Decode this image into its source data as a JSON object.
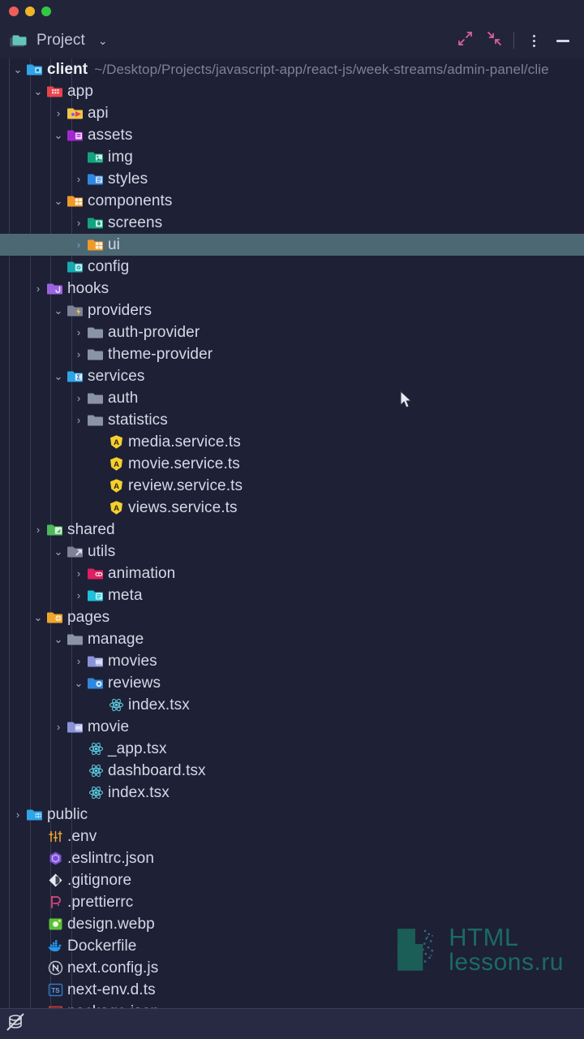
{
  "window": {
    "traffic_lights": [
      "close-red",
      "minimize-yellow",
      "maximize-green"
    ]
  },
  "toolbar": {
    "panel_title": "Project",
    "panel_icon": "folders-icon",
    "dropdown_icon": "chevron-down-icon",
    "expand_all_label": "expand-all-icon",
    "collapse_all_label": "collapse-all-icon",
    "options_label": "kebab-menu-icon",
    "minimize_label": "minimize-icon"
  },
  "colors": {
    "background": "#1e2035",
    "selection": "#4c6873",
    "text": "#d4d8e6",
    "path_text": "#7d8296",
    "accent_pink": "#e0629b",
    "arrow_blue": "#6ba4dd",
    "watermark": "#1b6b63"
  },
  "statusbar": {
    "icon": "database-off-icon"
  },
  "watermark": {
    "line1": "HTML",
    "line2": "lessons.ru",
    "logo": "h-letter-logo"
  },
  "tree": {
    "rows": [
      {
        "depth": 0,
        "toggle": "down",
        "icon": "module-folder-icon",
        "label": "client",
        "bold": true,
        "path": "~/Desktop/Projects/javascript-app/react-js/week-streams/admin-panel/clie"
      },
      {
        "depth": 1,
        "toggle": "down",
        "icon": "app-folder-icon",
        "label": "app"
      },
      {
        "depth": 2,
        "toggle": "right",
        "icon": "api-folder-icon",
        "label": "api"
      },
      {
        "depth": 2,
        "toggle": "down",
        "icon": "assets-folder-icon",
        "label": "assets"
      },
      {
        "depth": 3,
        "toggle": "none",
        "icon": "image-folder-icon",
        "label": "img"
      },
      {
        "depth": 3,
        "toggle": "right",
        "icon": "styles-folder-icon",
        "label": "styles"
      },
      {
        "depth": 2,
        "toggle": "down",
        "icon": "components-folder-icon",
        "label": "components"
      },
      {
        "depth": 3,
        "toggle": "right",
        "icon": "screens-folder-icon",
        "label": "screens"
      },
      {
        "depth": 3,
        "toggle": "right",
        "icon": "ui-folder-icon",
        "label": "ui",
        "selected": true
      },
      {
        "depth": 2,
        "toggle": "none",
        "icon": "config-folder-icon",
        "label": "config"
      },
      {
        "depth": 1,
        "toggle": "right",
        "icon": "hooks-folder-icon",
        "label": "hooks"
      },
      {
        "depth": 2,
        "toggle": "down",
        "icon": "providers-folder-icon",
        "label": "providers"
      },
      {
        "depth": 3,
        "toggle": "right",
        "icon": "plain-folder-icon",
        "label": "auth-provider"
      },
      {
        "depth": 3,
        "toggle": "right",
        "icon": "plain-folder-icon",
        "label": "theme-provider"
      },
      {
        "depth": 2,
        "toggle": "down",
        "icon": "services-folder-icon",
        "label": "services"
      },
      {
        "depth": 3,
        "toggle": "right",
        "icon": "plain-folder-icon",
        "label": "auth"
      },
      {
        "depth": 3,
        "toggle": "right",
        "icon": "plain-folder-icon",
        "label": "statistics"
      },
      {
        "depth": 4,
        "toggle": "none",
        "icon": "angular-service-icon",
        "label": "media.service.ts"
      },
      {
        "depth": 4,
        "toggle": "none",
        "icon": "angular-service-icon",
        "label": "movie.service.ts"
      },
      {
        "depth": 4,
        "toggle": "none",
        "icon": "angular-service-icon",
        "label": "review.service.ts"
      },
      {
        "depth": 4,
        "toggle": "none",
        "icon": "angular-service-icon",
        "label": "views.service.ts"
      },
      {
        "depth": 1,
        "toggle": "right",
        "icon": "shared-folder-icon",
        "label": "shared"
      },
      {
        "depth": 2,
        "toggle": "down",
        "icon": "utils-folder-icon",
        "label": "utils"
      },
      {
        "depth": 3,
        "toggle": "right",
        "icon": "animation-folder-icon",
        "label": "animation"
      },
      {
        "depth": 3,
        "toggle": "right",
        "icon": "meta-folder-icon",
        "label": "meta"
      },
      {
        "depth": 1,
        "toggle": "down",
        "icon": "pages-folder-icon",
        "label": "pages"
      },
      {
        "depth": 2,
        "toggle": "down",
        "icon": "plain-folder-icon",
        "label": "manage"
      },
      {
        "depth": 3,
        "toggle": "right",
        "icon": "movies-folder-icon",
        "label": "movies"
      },
      {
        "depth": 3,
        "toggle": "down",
        "icon": "reviews-folder-icon",
        "label": "reviews"
      },
      {
        "depth": 4,
        "toggle": "none",
        "icon": "react-icon",
        "label": "index.tsx"
      },
      {
        "depth": 2,
        "toggle": "right",
        "icon": "movies-folder-icon",
        "label": "movie"
      },
      {
        "depth": 3,
        "toggle": "none",
        "icon": "react-icon",
        "label": "_app.tsx"
      },
      {
        "depth": 3,
        "toggle": "none",
        "icon": "react-icon",
        "label": "dashboard.tsx"
      },
      {
        "depth": 3,
        "toggle": "none",
        "icon": "react-icon",
        "label": "index.tsx"
      },
      {
        "depth": 0,
        "toggle": "right",
        "icon": "public-folder-icon",
        "label": "public"
      },
      {
        "depth": 1,
        "toggle": "none",
        "icon": "env-icon",
        "label": ".env"
      },
      {
        "depth": 1,
        "toggle": "none",
        "icon": "eslint-icon",
        "label": ".eslintrc.json"
      },
      {
        "depth": 1,
        "toggle": "none",
        "icon": "git-icon",
        "label": ".gitignore"
      },
      {
        "depth": 1,
        "toggle": "none",
        "icon": "prettier-icon",
        "label": ".prettierrc"
      },
      {
        "depth": 1,
        "toggle": "none",
        "icon": "image-file-icon",
        "label": "design.webp"
      },
      {
        "depth": 1,
        "toggle": "none",
        "icon": "docker-icon",
        "label": "Dockerfile"
      },
      {
        "depth": 1,
        "toggle": "none",
        "icon": "nextjs-icon",
        "label": "next.config.js"
      },
      {
        "depth": 1,
        "toggle": "none",
        "icon": "typescript-icon",
        "label": "next-env.d.ts"
      },
      {
        "depth": 1,
        "toggle": "none",
        "icon": "npm-icon",
        "label": "package.json"
      }
    ]
  }
}
